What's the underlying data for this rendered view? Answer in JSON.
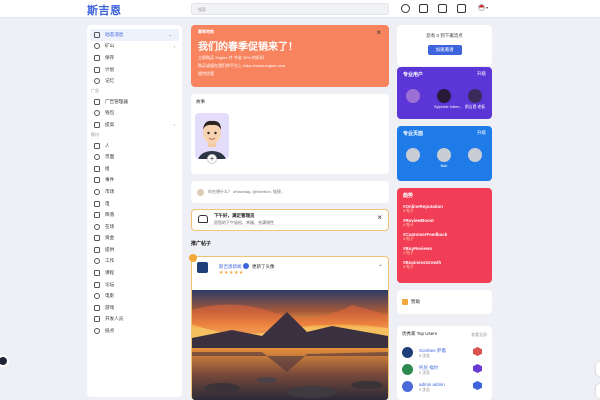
{
  "header": {
    "logo": "斯吉恩",
    "search_placeholder": "搜索"
  },
  "sidebar": {
    "items_top": [
      {
        "label": "动态消息",
        "active": true,
        "caret": "⌄",
        "icon": "feed-icon",
        "name": "sidebar-item-feed"
      },
      {
        "label": "矿山",
        "caret": "›",
        "icon": "mine-icon",
        "name": "sidebar-item-mine"
      },
      {
        "label": "保存",
        "icon": "bookmark-icon",
        "name": "sidebar-item-saved"
      },
      {
        "label": "计划",
        "icon": "calendar-icon",
        "name": "sidebar-item-schedule"
      },
      {
        "label": "记忆",
        "icon": "memory-icon",
        "name": "sidebar-item-memories"
      }
    ],
    "ads_heading": "广告",
    "items_ads": [
      {
        "label": "广告管理器",
        "icon": "ads-manager-icon",
        "name": "sidebar-item-ads-manager"
      },
      {
        "label": "钱包",
        "icon": "wallet-icon",
        "name": "sidebar-item-wallet"
      },
      {
        "label": "提高",
        "caret": "›",
        "icon": "boost-icon",
        "name": "sidebar-item-boost"
      }
    ],
    "explore_heading": "探讨",
    "items_explore": [
      {
        "label": "人",
        "icon": "people-icon",
        "name": "sidebar-item-people"
      },
      {
        "label": "页面",
        "icon": "pages-icon",
        "name": "sidebar-item-pages"
      },
      {
        "label": "组",
        "icon": "groups-icon",
        "name": "sidebar-item-groups"
      },
      {
        "label": "事件",
        "icon": "events-icon",
        "name": "sidebar-item-events"
      },
      {
        "label": "市场",
        "icon": "market-icon",
        "name": "sidebar-item-market"
      },
      {
        "label": "电",
        "icon": "bolt-icon",
        "name": "sidebar-item-electric"
      },
      {
        "label": "降落",
        "icon": "drop-icon",
        "name": "sidebar-item-drop"
      },
      {
        "label": "在场",
        "icon": "presence-icon",
        "name": "sidebar-item-presence"
      },
      {
        "label": "资金",
        "icon": "funding-icon",
        "name": "sidebar-item-funding"
      },
      {
        "label": "提供",
        "icon": "offers-icon",
        "name": "sidebar-item-offers"
      },
      {
        "label": "工作",
        "icon": "jobs-icon",
        "name": "sidebar-item-jobs"
      },
      {
        "label": "课程",
        "icon": "courses-icon",
        "name": "sidebar-item-courses"
      },
      {
        "label": "论坛",
        "icon": "forum-icon",
        "name": "sidebar-item-forum"
      },
      {
        "label": "电影",
        "icon": "movies-icon",
        "name": "sidebar-item-movies"
      },
      {
        "label": "游戏",
        "icon": "games-icon",
        "name": "sidebar-item-games"
      },
      {
        "label": "开发人员",
        "icon": "developers-icon",
        "name": "sidebar-item-developers"
      },
      {
        "label": "抵点",
        "icon": "points-icon",
        "name": "sidebar-item-points"
      }
    ]
  },
  "promo": {
    "label": "春季特卖",
    "title": "我们的春季促销来了！",
    "line1": "立即购买 Sngine 并 节省 30% 的折扣",
    "line2": "购买或留在我们的平台上 https://www.sngine.com",
    "line3": "提供优惠"
  },
  "stories": {
    "label": "故事"
  },
  "composer": {
    "placeholder": "你在想什么？ #Hashtag..@Mention. 链接..."
  },
  "notice": {
    "title": "下午好，满足管理员",
    "subtitle": "愿您的下午轻松、幸福、充满韧性"
  },
  "promoted_title": "推广帖子",
  "post": {
    "author": "斯吉恩新闻",
    "action": "更新了头像",
    "stars": "★★★★★"
  },
  "invite": {
    "text": "您有 0 到下邀流点",
    "button": "加速邀请"
  },
  "pro_users": {
    "title": "专业用户",
    "upgrade": "升级",
    "users": [
      {
        "name": "",
        "color": "#9b6fd6"
      },
      {
        "name": "Sylphide Intern...",
        "color": "#2a1a3a"
      },
      {
        "name": "斯吉恩 老板",
        "color": "#3a2a5a"
      }
    ]
  },
  "pro_pages": {
    "title": "专业页面",
    "upgrade": "升级",
    "pages": [
      {
        "name": "",
        "color": "#c9cdd6"
      },
      {
        "name": "Bab",
        "color": "#c9cdd6"
      },
      {
        "name": "",
        "color": "#c9cdd6"
      }
    ]
  },
  "trending": {
    "title": "趋势",
    "tags": [
      {
        "tag": "#OnlineReputation",
        "count": "4 帖子"
      },
      {
        "tag": "#ReviewBoost",
        "count": "4 帖子"
      },
      {
        "tag": "#CustomerFeedback",
        "count": "4 帖子"
      },
      {
        "tag": "#BuyReviews",
        "count": "4 帖子"
      },
      {
        "tag": "#BusinessGrowth",
        "count": "4 帖子"
      }
    ]
  },
  "donate": {
    "label": "赞助"
  },
  "top_users": {
    "title": "优秀家 Top Users",
    "more": "查看全部",
    "users": [
      {
        "name": "Sombee 萨着",
        "sub": "5 沈浩",
        "color": "#1e3f7a",
        "hex": "#d9534f"
      },
      {
        "name": "托尼 福尔",
        "sub": "0 沈浩",
        "color": "#2d8a4e",
        "hex": "#6b3ad1"
      },
      {
        "name": "admin admin",
        "sub": "0 沈浩",
        "color": "#4a6bd8",
        "hex": "#3d63dd"
      }
    ]
  }
}
